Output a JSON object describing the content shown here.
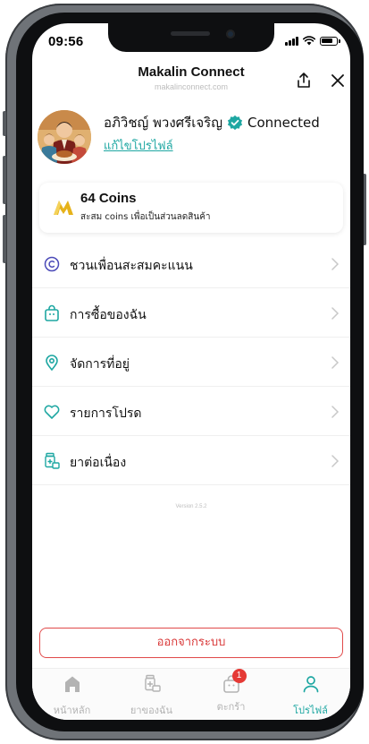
{
  "status_bar": {
    "time": "09:56"
  },
  "header": {
    "title": "Makalin Connect",
    "subtitle": "makalinconnect.com"
  },
  "profile": {
    "name": "อภิวิชญ์ พวงศรีเจริญ",
    "status": "Connected",
    "edit_label": "แก้ไขโปรไฟล์"
  },
  "coins": {
    "title": "64 Coins",
    "subtitle": "สะสม coins เพื่อเป็นส่วนลดสินค้า"
  },
  "menu": [
    {
      "label": "ชวนเพื่อนสะสมคะแนน",
      "icon": "copyright-circle-icon"
    },
    {
      "label": "การซื้อของฉัน",
      "icon": "shopping-bag-icon"
    },
    {
      "label": "จัดการที่อยู่",
      "icon": "location-pin-icon"
    },
    {
      "label": "รายการโปรด",
      "icon": "heart-icon"
    },
    {
      "label": "ยาต่อเนื่อง",
      "icon": "medicine-icon"
    }
  ],
  "version": "Version 2.5.2",
  "logout_label": "ออกจากระบบ",
  "bottom_nav": {
    "home": "หน้าหลัก",
    "my_meds": "ยาของฉัน",
    "cart": "ตะกร้า",
    "cart_badge": "1",
    "profile": "โปรไฟล์"
  },
  "colors": {
    "accent": "#1ea7a2",
    "danger": "#e04a4a",
    "inactive": "#b3b3b3"
  }
}
